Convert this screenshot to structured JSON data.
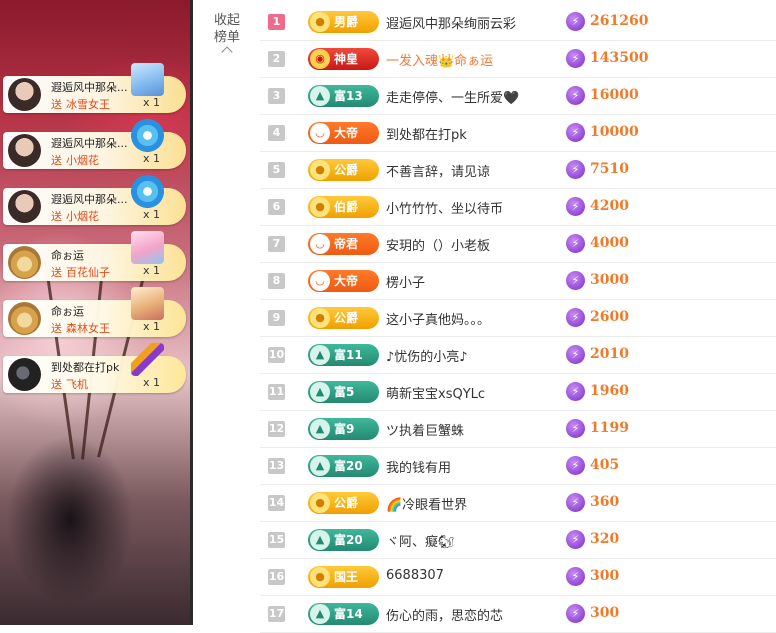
{
  "panel": {
    "collapse_label_1": "收起",
    "collapse_label_2": "榜单"
  },
  "gift_feed": [
    {
      "user": "遐逅风中那朵...",
      "send": "送",
      "gift": "冰雪女王",
      "count": "x 1",
      "avatar": "girl"
    },
    {
      "user": "遐逅风中那朵...",
      "send": "送",
      "gift": "小烟花",
      "count": "x 1",
      "avatar": "girl"
    },
    {
      "user": "遐逅风中那朵...",
      "send": "送",
      "gift": "小烟花",
      "count": "x 1",
      "avatar": "girl"
    },
    {
      "user": "命ぉ运",
      "send": "送",
      "gift": "百花仙子",
      "count": "x 1",
      "avatar": "cat"
    },
    {
      "user": "命ぉ运",
      "send": "送",
      "gift": "森林女王",
      "count": "x 1",
      "avatar": "cat"
    },
    {
      "user": "到处都在打pk",
      "send": "送",
      "gift": "飞机",
      "count": "x 1",
      "avatar": "dark"
    }
  ],
  "ranking": [
    {
      "rank": "1",
      "badge": "男爵",
      "badge_style": "gold",
      "name": "遐逅风中那朵绚丽云彩",
      "score": "261260"
    },
    {
      "rank": "2",
      "badge": "神皇",
      "badge_style": "red",
      "name": "一发入魂👑命ぁ运",
      "score": "143500",
      "highlight": true
    },
    {
      "rank": "3",
      "badge": "富13",
      "badge_style": "teal",
      "name": "走走停停、一生所爱🖤",
      "score": "16000"
    },
    {
      "rank": "4",
      "badge": "大帝",
      "badge_style": "orange",
      "name": "到处都在打pk",
      "score": "10000"
    },
    {
      "rank": "5",
      "badge": "公爵",
      "badge_style": "gold",
      "name": "不善言辞，请见谅",
      "score": "7510"
    },
    {
      "rank": "6",
      "badge": "伯爵",
      "badge_style": "gold",
      "name": "小竹竹竹、坐以待币",
      "score": "4200"
    },
    {
      "rank": "7",
      "badge": "帝君",
      "badge_style": "orange",
      "name": "安玥的（）小老板",
      "score": "4000"
    },
    {
      "rank": "8",
      "badge": "大帝",
      "badge_style": "orange",
      "name": "楞小子",
      "score": "3000"
    },
    {
      "rank": "9",
      "badge": "公爵",
      "badge_style": "gold",
      "name": "这小子真他妈。。。",
      "score": "2600"
    },
    {
      "rank": "10",
      "badge": "富11",
      "badge_style": "teal",
      "name": "♪忧伤的小亮♪",
      "score": "2010"
    },
    {
      "rank": "11",
      "badge": "富5",
      "badge_style": "teal",
      "name": "萌新宝宝xsQYLc",
      "score": "1960"
    },
    {
      "rank": "12",
      "badge": "富9",
      "badge_style": "teal",
      "name": "ツ执着巨蟹蛛",
      "score": "1199"
    },
    {
      "rank": "13",
      "badge": "富20",
      "badge_style": "teal",
      "name": "我的钱有用",
      "score": "405"
    },
    {
      "rank": "14",
      "badge": "公爵",
      "badge_style": "gold",
      "name": "🌈冷眼看世界",
      "score": "360"
    },
    {
      "rank": "15",
      "badge": "富20",
      "badge_style": "teal",
      "name": "ヾ阿、癡🐿",
      "score": "320"
    },
    {
      "rank": "16",
      "badge": "国王",
      "badge_style": "gold",
      "name": "6688307",
      "score": "300"
    },
    {
      "rank": "17",
      "badge": "富14",
      "badge_style": "teal",
      "name": "伤心的雨，思恋的芯",
      "score": "300"
    }
  ],
  "colors": {
    "score": "#f07a2a",
    "rank_first": "#f06a8a",
    "rank_default": "#c8c8c8",
    "gift_text": "#e64a19"
  }
}
